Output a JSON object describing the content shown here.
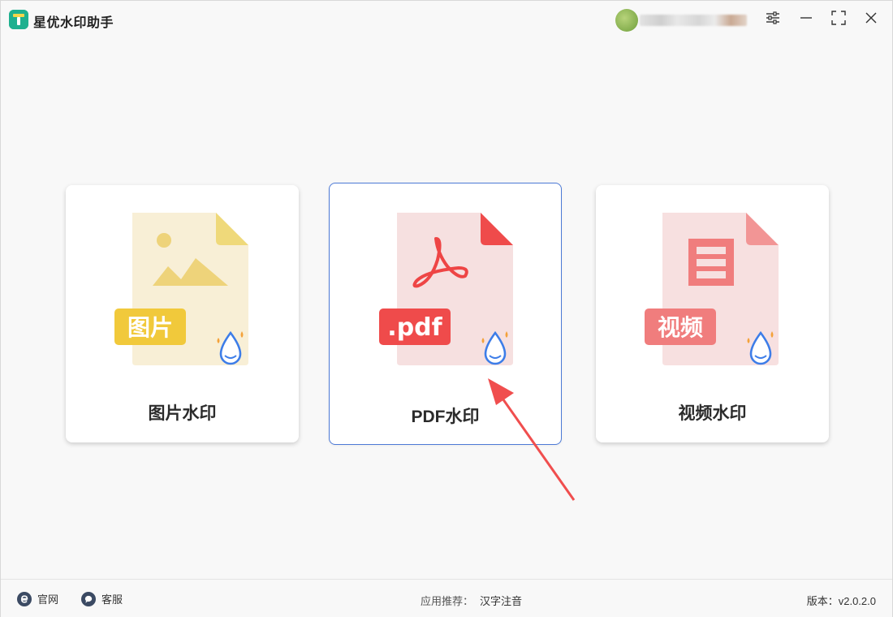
{
  "app": {
    "title": "星优水印助手",
    "accent": "#1fb08f"
  },
  "titlebar": {
    "icons": [
      "settings-sliders-icon",
      "minimize-icon",
      "maximize-icon",
      "close-icon"
    ]
  },
  "cards": [
    {
      "label": "图片水印",
      "badge": "图片",
      "file_color": "#f8efd6",
      "badge_color": "#f1c93b",
      "selected": false
    },
    {
      "label": "PDF水印",
      "badge": ".pdf",
      "file_color": "#f6e0e0",
      "badge_color": "#ef4b4b",
      "selected": true
    },
    {
      "label": "视频水印",
      "badge": "视频",
      "file_color": "#f7e0e0",
      "badge_color": "#f07d7d",
      "selected": false
    }
  ],
  "footer": {
    "website_label": "官网",
    "support_label": "客服",
    "recommend_prefix": "应用推荐：",
    "recommend_link": "汉字注音",
    "version": "版本：v2.0.2.0"
  },
  "colors": {
    "selected_border": "#4d7ad6",
    "arrow": "#f04e4e",
    "drop_icon": "#3d7de8"
  }
}
